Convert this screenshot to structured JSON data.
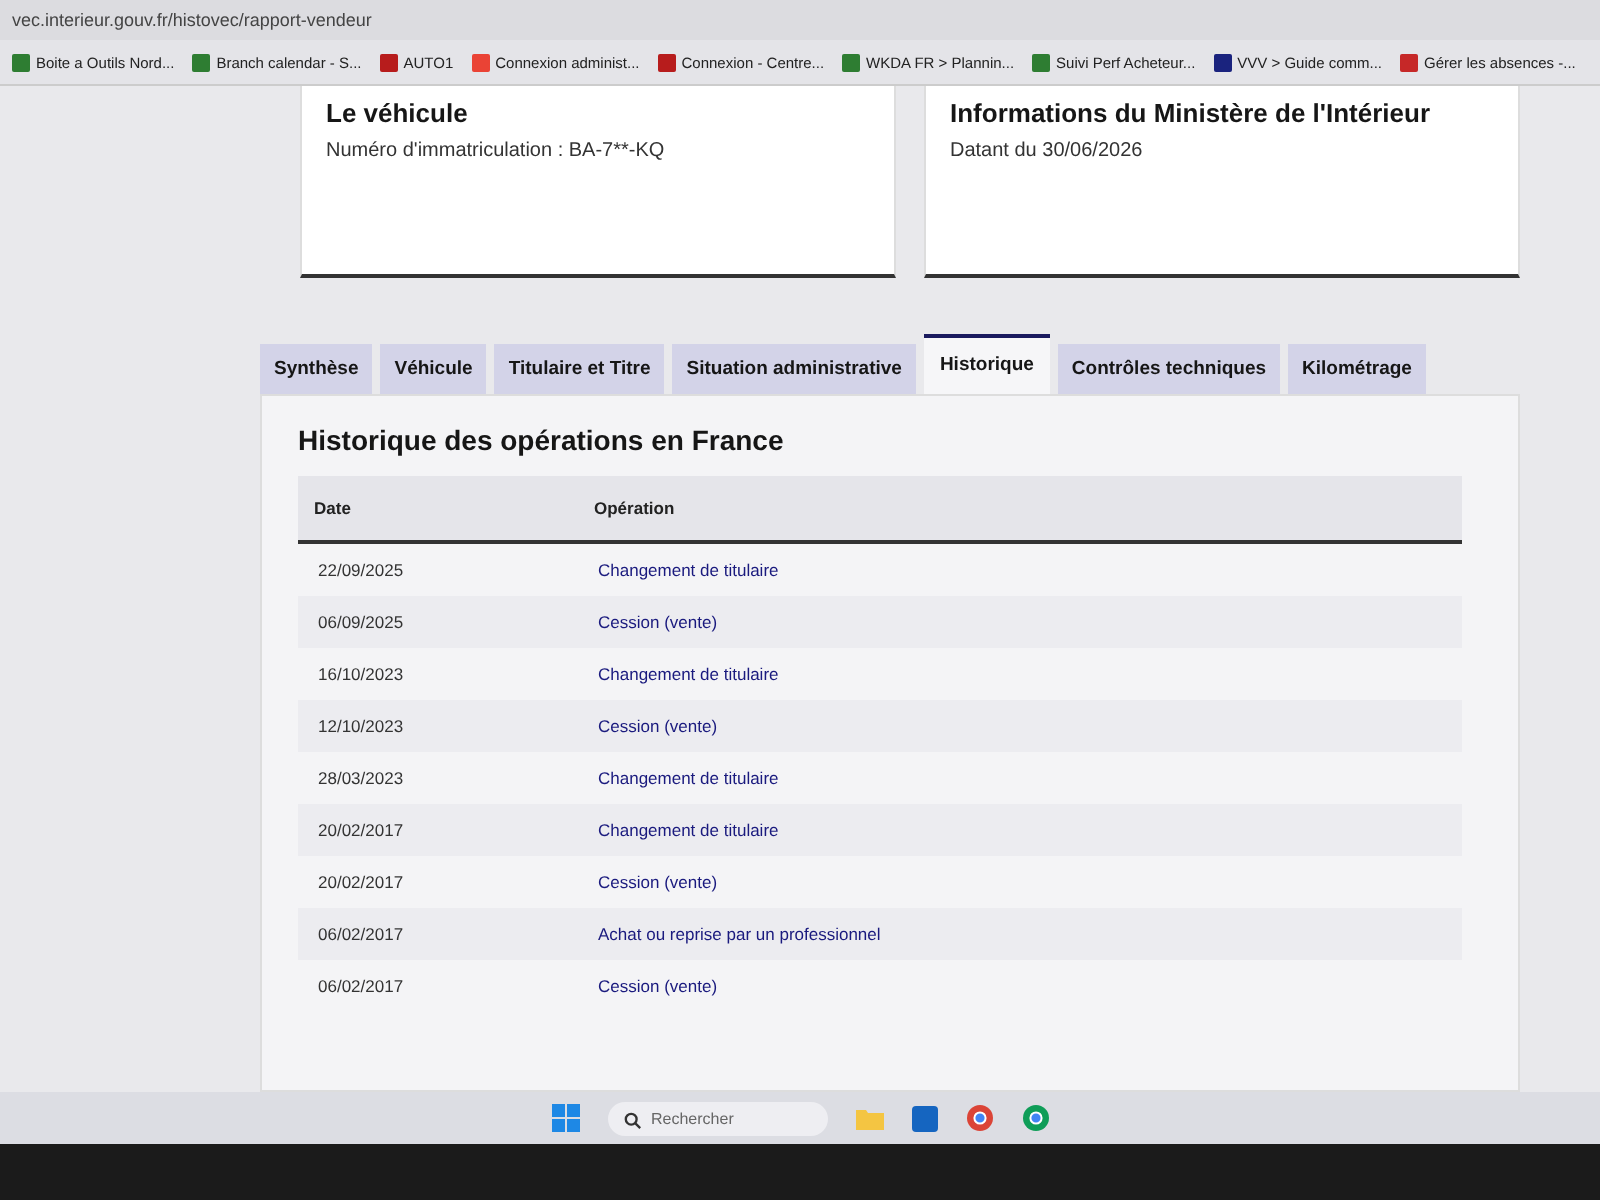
{
  "browser": {
    "url": "vec.interieur.gouv.fr/histovec/rapport-vendeur",
    "bookmarks": [
      {
        "label": "Boite a Outils Nord...",
        "color": "#2e7d32"
      },
      {
        "label": "Branch calendar - S...",
        "color": "#2e7d32"
      },
      {
        "label": "AUTO1",
        "color": "#b71c1c"
      },
      {
        "label": "Connexion administ...",
        "color": "#ea4335"
      },
      {
        "label": "Connexion - Centre...",
        "color": "#b71c1c"
      },
      {
        "label": "WKDA FR > Plannin...",
        "color": "#2e7d32"
      },
      {
        "label": "Suivi Perf Acheteur...",
        "color": "#2e7d32"
      },
      {
        "label": "VVV > Guide comm...",
        "color": "#1a237e"
      },
      {
        "label": "Gérer les absences -...",
        "color": "#c62828"
      }
    ]
  },
  "cards": [
    {
      "title": "Le véhicule",
      "text": "Numéro d'immatriculation : BA-7**-KQ"
    },
    {
      "title": "Informations du Ministère de l'Intérieur",
      "text": "Datant du 30/06/2026"
    }
  ],
  "tabs": [
    {
      "label": "Synthèse",
      "selected": false
    },
    {
      "label": "Véhicule",
      "selected": false
    },
    {
      "label": "Titulaire et Titre",
      "selected": false
    },
    {
      "label": "Situation administrative",
      "selected": false
    },
    {
      "label": "Historique",
      "selected": true
    },
    {
      "label": "Contrôles techniques",
      "selected": false
    },
    {
      "label": "Kilométrage",
      "selected": false
    }
  ],
  "history": {
    "title": "Historique des opérations en France",
    "columns": [
      "Date",
      "Opération"
    ],
    "rows": [
      [
        "22/09/2025",
        "Changement de titulaire"
      ],
      [
        "06/09/2025",
        "Cession (vente)"
      ],
      [
        "16/10/2023",
        "Changement de titulaire"
      ],
      [
        "12/10/2023",
        "Cession (vente)"
      ],
      [
        "28/03/2023",
        "Changement de titulaire"
      ],
      [
        "20/02/2017",
        "Changement de titulaire"
      ],
      [
        "20/02/2017",
        "Cession (vente)"
      ],
      [
        "06/02/2017",
        "Achat ou reprise par un professionnel"
      ],
      [
        "06/02/2017",
        "Cession (vente)"
      ]
    ]
  },
  "taskbar": {
    "search_placeholder": "Rechercher"
  }
}
